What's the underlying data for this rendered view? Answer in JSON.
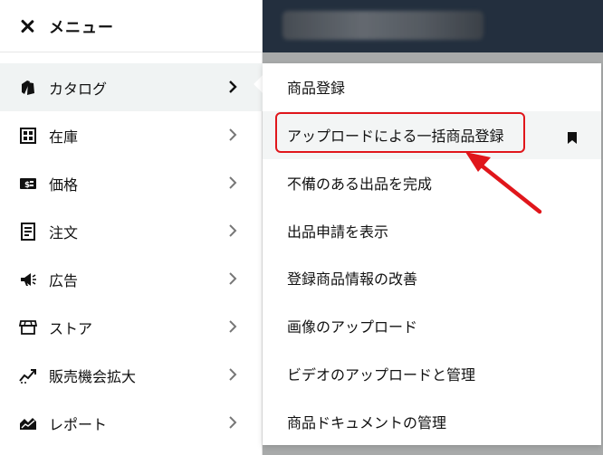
{
  "menu": {
    "title": "メニュー"
  },
  "sidebar": {
    "items": [
      {
        "label": "カタログ",
        "icon": "catalog-tag-icon",
        "active": true
      },
      {
        "label": "在庫",
        "icon": "inventory-icon"
      },
      {
        "label": "価格",
        "icon": "price-icon"
      },
      {
        "label": "注文",
        "icon": "orders-icon"
      },
      {
        "label": "広告",
        "icon": "megaphone-icon"
      },
      {
        "label": "ストア",
        "icon": "storefront-icon"
      },
      {
        "label": "販売機会拡大",
        "icon": "growth-chart-icon"
      },
      {
        "label": "レポート",
        "icon": "reports-icon"
      }
    ]
  },
  "submenu": {
    "items": [
      {
        "label": "商品登録"
      },
      {
        "label": "アップロードによる一括商品登録",
        "bookmarked": true
      },
      {
        "label": "不備のある出品を完成"
      },
      {
        "label": "出品申請を表示"
      },
      {
        "label": "登録商品情報の改善"
      },
      {
        "label": "画像のアップロード"
      },
      {
        "label": "ビデオのアップロードと管理"
      },
      {
        "label": "商品ドキュメントの管理"
      }
    ]
  },
  "colors": {
    "highlight": "#e0161b",
    "header": "#232f3e"
  }
}
